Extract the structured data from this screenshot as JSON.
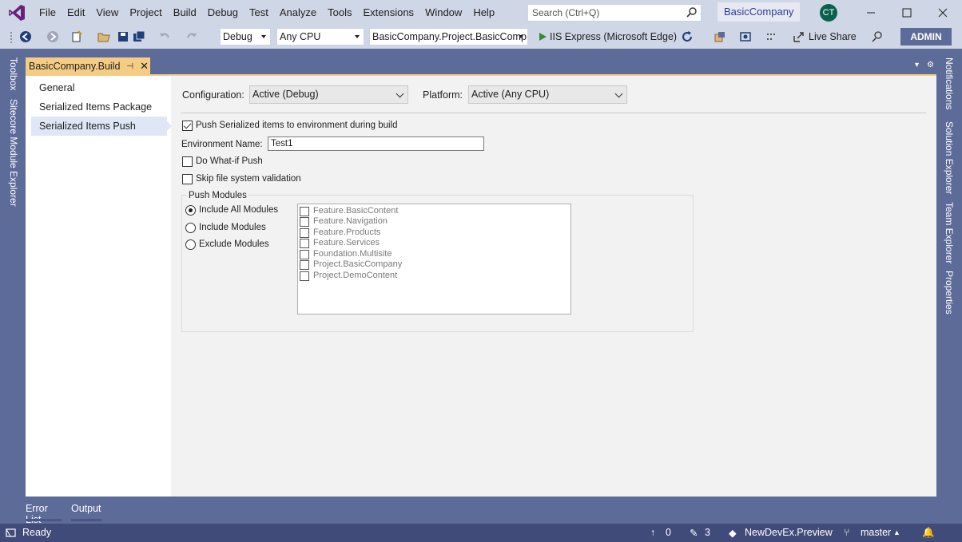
{
  "menu": {
    "items": [
      "File",
      "Edit",
      "View",
      "Project",
      "Build",
      "Debug",
      "Test",
      "Analyze",
      "Tools",
      "Extensions",
      "Window",
      "Help"
    ],
    "search_placeholder": "Search (Ctrl+Q)",
    "solution_name": "BasicCompany",
    "avatar_initials": "CT"
  },
  "toolbar": {
    "configuration": "Debug",
    "platform": "Any CPU",
    "startup_project": "BasicCompany.Project.BasicComp",
    "run_target": "IIS Express (Microsoft Edge)",
    "live_share": "Live Share",
    "admin_label": "ADMIN"
  },
  "left_tabs": [
    "Toolbox",
    "Sitecore Module Explorer"
  ],
  "right_tabs": [
    "Notifications",
    "Solution Explorer",
    "Team Explorer",
    "Properties"
  ],
  "document_tab": {
    "title": "BasicCompany.Build"
  },
  "nav": {
    "items": [
      "General",
      "Serialized Items Package",
      "Serialized Items Push"
    ],
    "selected_index": 2
  },
  "settings": {
    "configuration_label": "Configuration:",
    "configuration_value": "Active (Debug)",
    "platform_label": "Platform:",
    "platform_value": "Active (Any CPU)",
    "push_label": "Push Serialized items to environment during build",
    "push_checked": true,
    "env_label": "Environment Name:",
    "env_value": "Test1",
    "whatif_label": "Do What-if Push",
    "whatif_checked": false,
    "skip_label": "Skip file system validation",
    "skip_checked": false
  },
  "push_modules": {
    "title": "Push Modules",
    "options": [
      "Include All Modules",
      "Include Modules",
      "Exclude Modules"
    ],
    "selected_index": 0,
    "modules": [
      "Feature.BasicContent",
      "Feature.Navigation",
      "Feature.Products",
      "Feature.Services",
      "Foundation.Multisite",
      "Project.BasicCompany",
      "Project.DemoContent"
    ]
  },
  "bottom_tabs": [
    "Error List",
    "Output"
  ],
  "status": {
    "ready": "Ready",
    "up_count": "0",
    "edit_count": "3",
    "repo": "NewDevEx.Preview",
    "branch": "master"
  },
  "colors": {
    "accent": "#5d6b99",
    "tab_active": "#f5cc84",
    "status_bar": "#404b7a",
    "chrome": "#cfd6e5"
  }
}
